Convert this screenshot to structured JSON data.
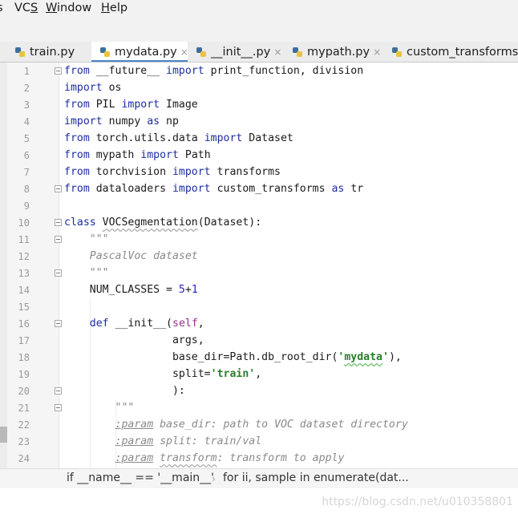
{
  "menubar": {
    "items": [
      {
        "label": "s"
      },
      {
        "mn": "VC",
        "rest": "S"
      },
      {
        "mn": "W",
        "rest": "indow"
      },
      {
        "mn": "H",
        "rest": "elp"
      }
    ]
  },
  "tabs": [
    {
      "label": "train.py",
      "close": ""
    },
    {
      "label": "mydata.py",
      "close": "×"
    },
    {
      "label": "__init__.py",
      "close": "×"
    },
    {
      "label": "mypath.py",
      "close": "×"
    },
    {
      "label": "custom_transforms.p",
      "close": ""
    }
  ],
  "code": {
    "line_numbers": [
      "1",
      "2",
      "3",
      "4",
      "5",
      "6",
      "7",
      "8",
      "9",
      "10",
      "11",
      "12",
      "13",
      "14",
      "15",
      "16",
      "17",
      "18",
      "19",
      "20",
      "21",
      "22",
      "23",
      "24"
    ],
    "tokens": {
      "l1": [
        "from",
        " __future__ ",
        "import",
        " print_function, division"
      ],
      "l2": [
        "import",
        " os"
      ],
      "l3": [
        "from",
        " PIL ",
        "import",
        " Image"
      ],
      "l4": [
        "import",
        " numpy ",
        "as",
        " np"
      ],
      "l5": [
        "from",
        " torch.utils.data ",
        "import",
        " Dataset"
      ],
      "l6": [
        "from",
        " mypath ",
        "import",
        " Path"
      ],
      "l7": [
        "from",
        " torchvision ",
        "import",
        " transforms"
      ],
      "l8": [
        "from",
        " dataloaders ",
        "import",
        " custom_transforms ",
        "as",
        " tr"
      ],
      "l10": [
        "class",
        " ",
        "VOCSegmentation",
        "(Dataset):"
      ],
      "l11": [
        "    \"\"\""
      ],
      "l12": [
        "    ",
        "PascalVoc dataset"
      ],
      "l13": [
        "    \"\"\""
      ],
      "l14": [
        "    NUM_CLASSES = ",
        "5",
        "+",
        "1"
      ],
      "l16": [
        "    ",
        "def",
        " __init__(",
        "self",
        ","
      ],
      "l17": [
        "                 args,"
      ],
      "l18": [
        "                 base_dir=Path.db_root_dir(",
        "'",
        "mydata",
        "'",
        "),"
      ],
      "l19": [
        "                 split=",
        "'train'",
        ","
      ],
      "l20": [
        "                 ):"
      ],
      "l21": [
        "        \"\"\""
      ],
      "l22": [
        "        ",
        ":param",
        " base_dir: path to VOC dataset directory"
      ],
      "l23": [
        "        ",
        ":param",
        " split: train/val"
      ],
      "l24": [
        "        ",
        ":param",
        " ",
        "transform",
        ": transform to apply"
      ]
    }
  },
  "breadcrumb": {
    "first": "if __name__ == '__main__'",
    "sep": "›",
    "second": "for ii, sample in enumerate(dat..."
  },
  "watermark": "https://blog.csdn.net/u010358801",
  "colors": {
    "keyword": "#1d2ca2",
    "string": "#2a7e2a",
    "docstring": "#8a8a8a",
    "number": "#2323cc",
    "self": "#93318c",
    "active_tab_underline": "#4a88c7"
  }
}
